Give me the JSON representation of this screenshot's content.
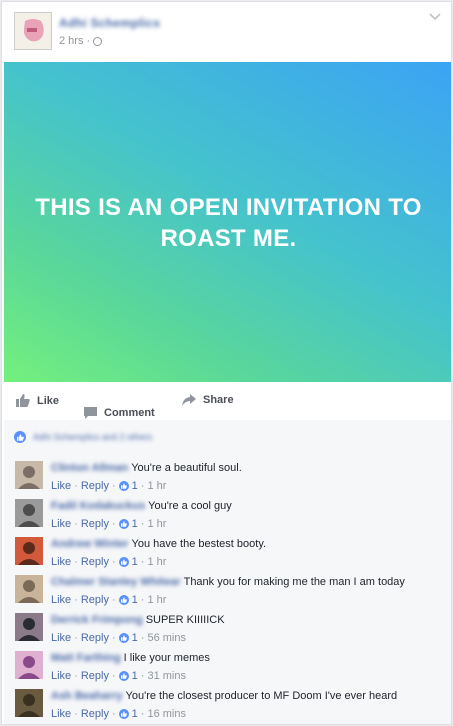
{
  "post": {
    "author": "Adhi Schemplics",
    "time": "2 hrs",
    "separator": "·",
    "banner_text": "THIS IS AN OPEN INVITATION TO ROAST ME."
  },
  "actions": {
    "like": "Like",
    "comment": "Comment",
    "share": "Share"
  },
  "likes": {
    "summary": "Adhi Schemplics and 2 others"
  },
  "comments": [
    {
      "name": "Clinton Allman",
      "text": "You're a beautiful soul.",
      "likes": "1",
      "time": "1 hr"
    },
    {
      "name": "Fadil Kodakuckus",
      "text": "You're a cool guy",
      "likes": "1",
      "time": "1 hr"
    },
    {
      "name": "Andrew Winter",
      "text": "You have the bestest booty.",
      "likes": "1",
      "time": "1 hr"
    },
    {
      "name": "Chalmer Stanley Whitear",
      "text": "Thank you for making me the man I am today",
      "likes": "1",
      "time": "1 hr"
    },
    {
      "name": "Derrick Frimpong",
      "text": "SUPER KIIIIICK",
      "likes": "1",
      "time": "56 mins"
    },
    {
      "name": "Matt Farthing",
      "text": "I like your memes",
      "likes": "1",
      "time": "31 mins"
    },
    {
      "name": "Ash Beaharry",
      "text": "You're the closest producer to MF Doom I've ever heard",
      "likes": "1",
      "time": "16 mins"
    }
  ],
  "comment_actions": {
    "like": "Like",
    "reply": "Reply",
    "sep": "·"
  }
}
